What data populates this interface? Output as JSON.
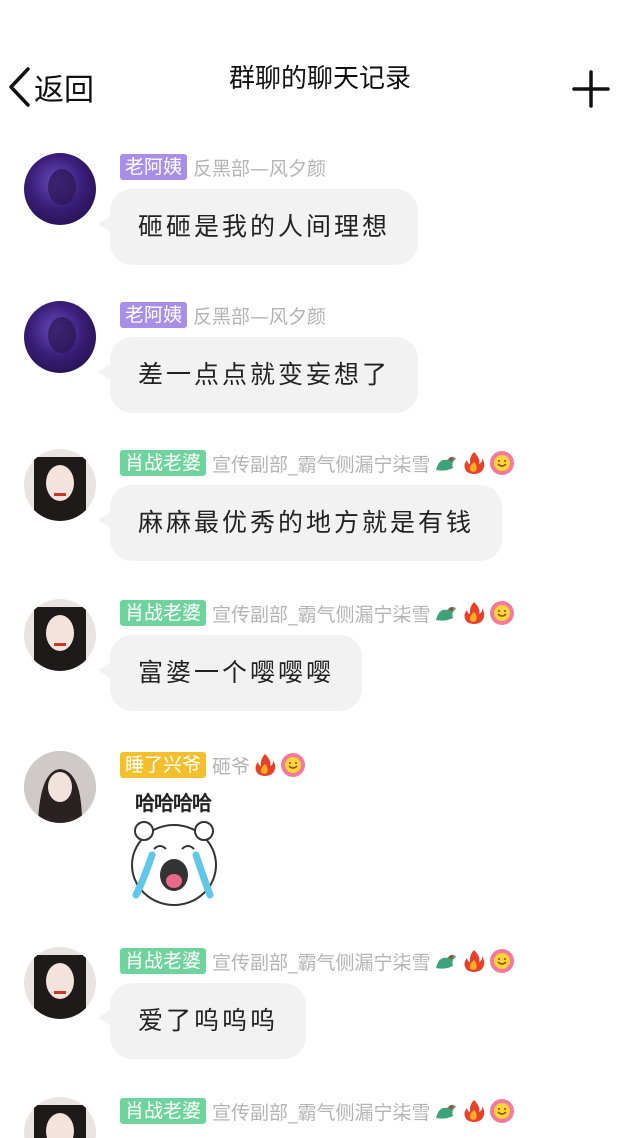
{
  "header": {
    "back_label": "返回",
    "title": "群聊的聊天记录"
  },
  "messages": [
    {
      "tag": "老阿姨",
      "sender": "反黑部—风夕颜",
      "text": "砸砸是我的人间理想"
    },
    {
      "tag": "老阿姨",
      "sender": "反黑部—风夕颜",
      "text": "差一点点就变妄想了"
    },
    {
      "tag": "肖战老婆",
      "sender": "宣传副部_霸气侧漏宁柒雪",
      "text": "麻麻最优秀的地方就是有钱"
    },
    {
      "tag": "肖战老婆",
      "sender": "宣传副部_霸气侧漏宁柒雪",
      "text": "富婆一个嘤嘤嘤"
    },
    {
      "tag": "睡了兴爷",
      "sender": "砸爷",
      "sticker_text": "哈哈哈哈"
    },
    {
      "tag": "肖战老婆",
      "sender": "宣传副部_霸气侧漏宁柒雪",
      "text": "爱了呜呜呜"
    },
    {
      "tag": "肖战老婆",
      "sender": "宣传副部_霸气侧漏宁柒雪"
    }
  ],
  "colors": {
    "tag_purple": "#a98ee8",
    "tag_green": "#6fd39d",
    "tag_yellow": "#f3bf2c",
    "bubble": "#f2f2f2",
    "sender_text": "#b4b4b4"
  },
  "icons": [
    "chevron-left-icon",
    "plus-icon",
    "dragon-badge-icon",
    "fire-badge-icon",
    "smile-badge-icon"
  ]
}
